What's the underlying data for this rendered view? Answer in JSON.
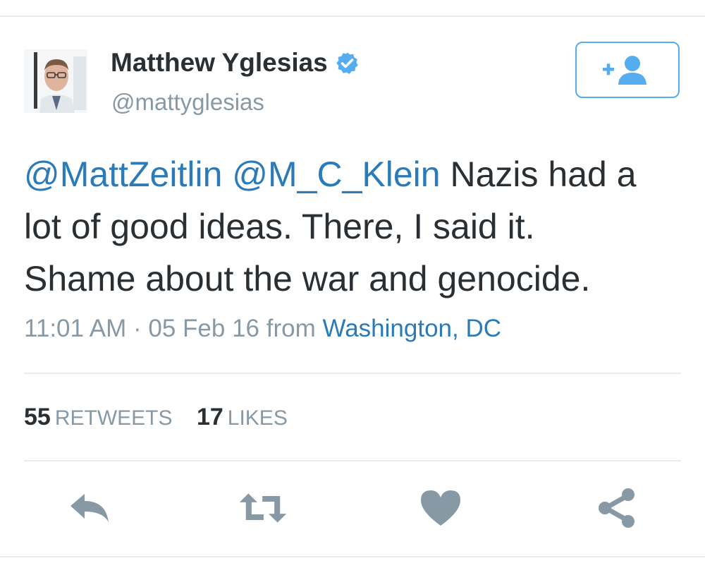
{
  "user": {
    "display_name": "Matthew Yglesias",
    "handle": "@mattyglesias",
    "verified": true
  },
  "follow_button": {
    "icon": "follow-user-icon"
  },
  "tweet": {
    "mention_1": "@MattZeitlin",
    "mention_2": "@M_C_Klein",
    "text_line_1": " Nazis had a",
    "text_line_2": "lot of good ideas. There, I said it.",
    "text_line_3": "Shame about the war and genocide."
  },
  "meta": {
    "time": "11:01 AM",
    "separator": " · ",
    "date": "05 Feb 16",
    "from_label": "from",
    "location": "Washington, DC"
  },
  "stats": {
    "retweets_count": "55",
    "retweets_label": "RETWEETS",
    "likes_count": "17",
    "likes_label": "LIKES"
  },
  "actions": [
    "reply-icon",
    "retweet-icon",
    "like-icon",
    "share-icon"
  ],
  "colors": {
    "accent": "#55acee",
    "link": "#2b7bb9",
    "text": "#292f33",
    "muted": "#8899a6",
    "icon": "#8899a6",
    "divider": "#e6ecf0"
  }
}
